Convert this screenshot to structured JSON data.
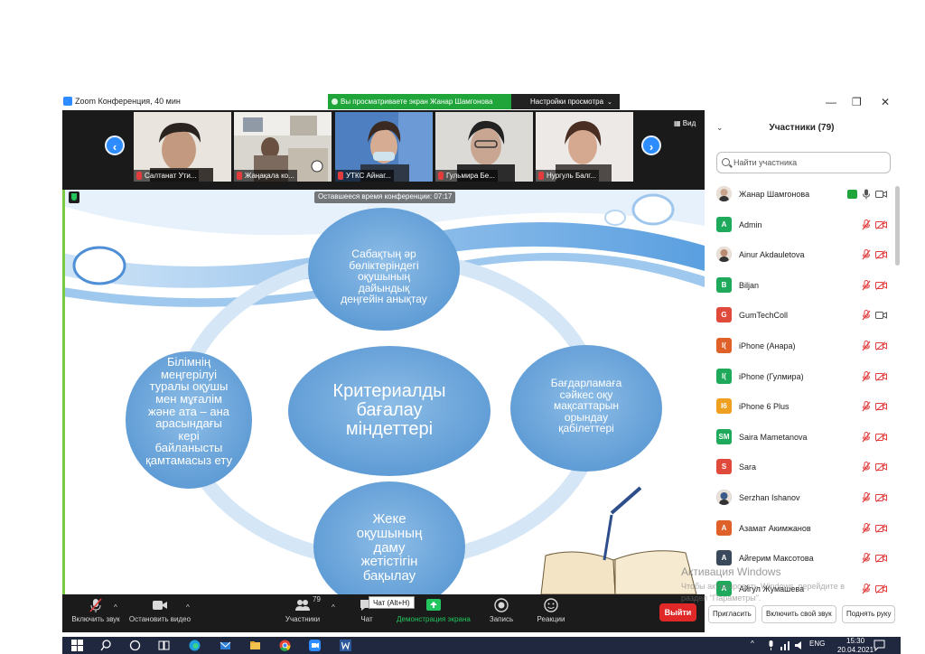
{
  "window": {
    "title": "Zoom Конференция, 40 мин",
    "share_banner": "Вы просматриваете экран Жанар Шамгонова",
    "view_settings": "Настройки просмотра",
    "view_button": "Вид",
    "remaining_time": "Оставшееся время конференции: 07:17"
  },
  "thumbnails": [
    {
      "name": "Салтанат Ути..."
    },
    {
      "name": "Жаңақала ко..."
    },
    {
      "name": "УТКС    Айнаг..."
    },
    {
      "name": "Гульмира Бе..."
    },
    {
      "name": "Нургуль Балг..."
    }
  ],
  "slide": {
    "center": [
      "Критериалды",
      "бағалау",
      "міндеттері"
    ],
    "top": [
      "Сабақтың әр",
      "бөліктеріндегі",
      "оқушының",
      "дайындық",
      "деңгейін анықтау"
    ],
    "left": [
      "Білімнің",
      "меңгерілуі",
      "туралы оқушы",
      "мен мұғалім",
      "және ата – ана",
      "арасындағы",
      "кері",
      "байланысты",
      "қамтамасыз ету"
    ],
    "right": [
      "Бағдарламаға",
      "сәйкес оқу",
      "мақсаттарын",
      "орындау",
      "қабілеттері"
    ],
    "bottom": [
      "Жеке",
      "оқушының",
      "даму",
      "жетістігін",
      "бақылау"
    ]
  },
  "toolbar": {
    "audio": "Включить звук",
    "video": "Остановить видео",
    "participants": "Участники",
    "participants_count": "79",
    "chat": "Чат",
    "chat_tooltip": "Чат (Alt+H)",
    "share": "Демонстрация экрана",
    "record": "Запись",
    "reactions": "Реакции",
    "leave": "Выйти"
  },
  "panel": {
    "title": "Участники (79)",
    "search_placeholder": "Найти участника",
    "participants": [
      {
        "name": "Жанар Шамгонова",
        "avatar": "",
        "color": "#c9a58e",
        "photo": true
      },
      {
        "name": "Admin",
        "avatar": "A",
        "color": "#1eaa5a"
      },
      {
        "name": "Ainur Akdauletova",
        "avatar": "",
        "color": "#b98b72",
        "photo": true
      },
      {
        "name": "Biljan",
        "avatar": "B",
        "color": "#1eaa5a"
      },
      {
        "name": "GumTechColl",
        "avatar": "G",
        "color": "#e04a3a"
      },
      {
        "name": "iPhone (Анара)",
        "avatar": "I(",
        "color": "#e0602a"
      },
      {
        "name": "iPhone (Гулмира)",
        "avatar": "I(",
        "color": "#1eaa5a"
      },
      {
        "name": "iPhone 6 Plus",
        "avatar": "I6",
        "color": "#f0a020"
      },
      {
        "name": "Saira Mametanova",
        "avatar": "SM",
        "color": "#1eaa5a"
      },
      {
        "name": "Sara",
        "avatar": "S",
        "color": "#e04a3a"
      },
      {
        "name": "Serzhan Ishanov",
        "avatar": "",
        "color": "#3a5a8a",
        "photo": true
      },
      {
        "name": "Азамат Акимжанов",
        "avatar": "А",
        "color": "#e0602a"
      },
      {
        "name": "Айгерим Максотова",
        "avatar": "А",
        "color": "#3a4a5c"
      },
      {
        "name": "Айгул Жумашева",
        "avatar": "А",
        "color": "#1eaa5a"
      }
    ],
    "invite": "Пригласить",
    "unmute": "Включить свой звук",
    "raise_hand": "Поднять руку"
  },
  "activation": {
    "title": "Активация Windows",
    "line1": "Чтобы активировать Windows, перейдите в",
    "line2": "раздел \"Параметры\"."
  },
  "taskbar": {
    "lang": "ENG",
    "time": "15:30",
    "date": "20.04.2021"
  },
  "colors": {
    "zoom_blue": "#2d8cff",
    "share_green": "#1fa53a",
    "leave_red": "#e02828",
    "bubble_blue": "#5b9bd5"
  }
}
